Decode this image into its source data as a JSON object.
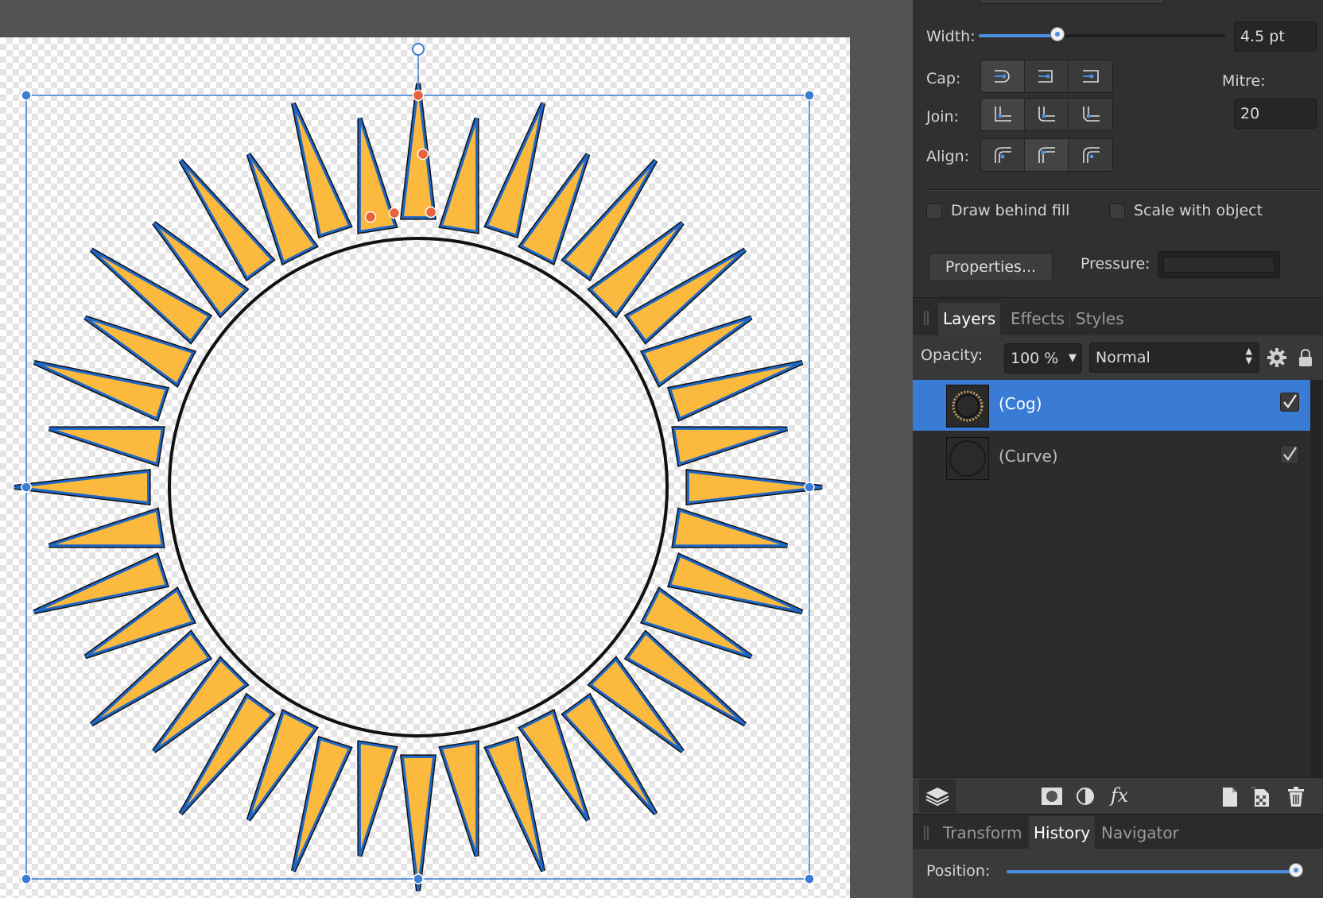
{
  "stroke": {
    "width_label": "Width:",
    "width_value": "4.5 pt",
    "width_fraction": 0.32,
    "cap_label": "Cap:",
    "join_label": "Join:",
    "align_label": "Align:",
    "mitre_label": "Mitre:",
    "mitre_value": "20",
    "cap_icons": [
      "butt-cap-icon",
      "round-cap-icon",
      "square-cap-icon"
    ],
    "join_icons": [
      "mitre-join-icon",
      "round-join-icon",
      "bevel-join-icon"
    ],
    "align_icons": [
      "inside-align-icon",
      "center-align-icon",
      "outside-align-icon"
    ],
    "draw_behind_fill_label": "Draw behind fill",
    "draw_behind_fill_checked": false,
    "scale_with_object_label": "Scale with object",
    "scale_with_object_checked": false,
    "properties_label": "Properties...",
    "pressure_label": "Pressure:"
  },
  "layers_panel": {
    "tabs": [
      "Layers",
      "Effects",
      "Styles"
    ],
    "active_tab": "Layers",
    "opacity_label": "Opacity:",
    "opacity_value": "100 %",
    "blend_mode": "Normal",
    "layers": [
      {
        "name": "(Cog)",
        "selected": true,
        "visible": true
      },
      {
        "name": "(Curve)",
        "selected": false,
        "visible": true
      }
    ],
    "bottom_icons": [
      "layers-icon",
      "mask-icon",
      "adjustment-icon",
      "fx-icon",
      "new-layer-icon",
      "new-pixel-layer-icon",
      "delete-icon"
    ],
    "fx_label": "fx"
  },
  "bottom_panel": {
    "tabs": [
      "Transform",
      "History",
      "Navigator"
    ],
    "active_tab": "History",
    "position_label": "Position:",
    "position_fraction": 1.0
  },
  "canvas": {
    "ray_count": 40,
    "ray_fill": "#fbb93e",
    "ray_stroke": "#1e66c8",
    "ray_outline": "#111111",
    "circle_stroke": "#111111",
    "selection_color": "#3a7bd5",
    "node_color": "#e8623a"
  },
  "colors": {
    "accent": "#3a7bd5",
    "panel_bg": "#303030"
  }
}
